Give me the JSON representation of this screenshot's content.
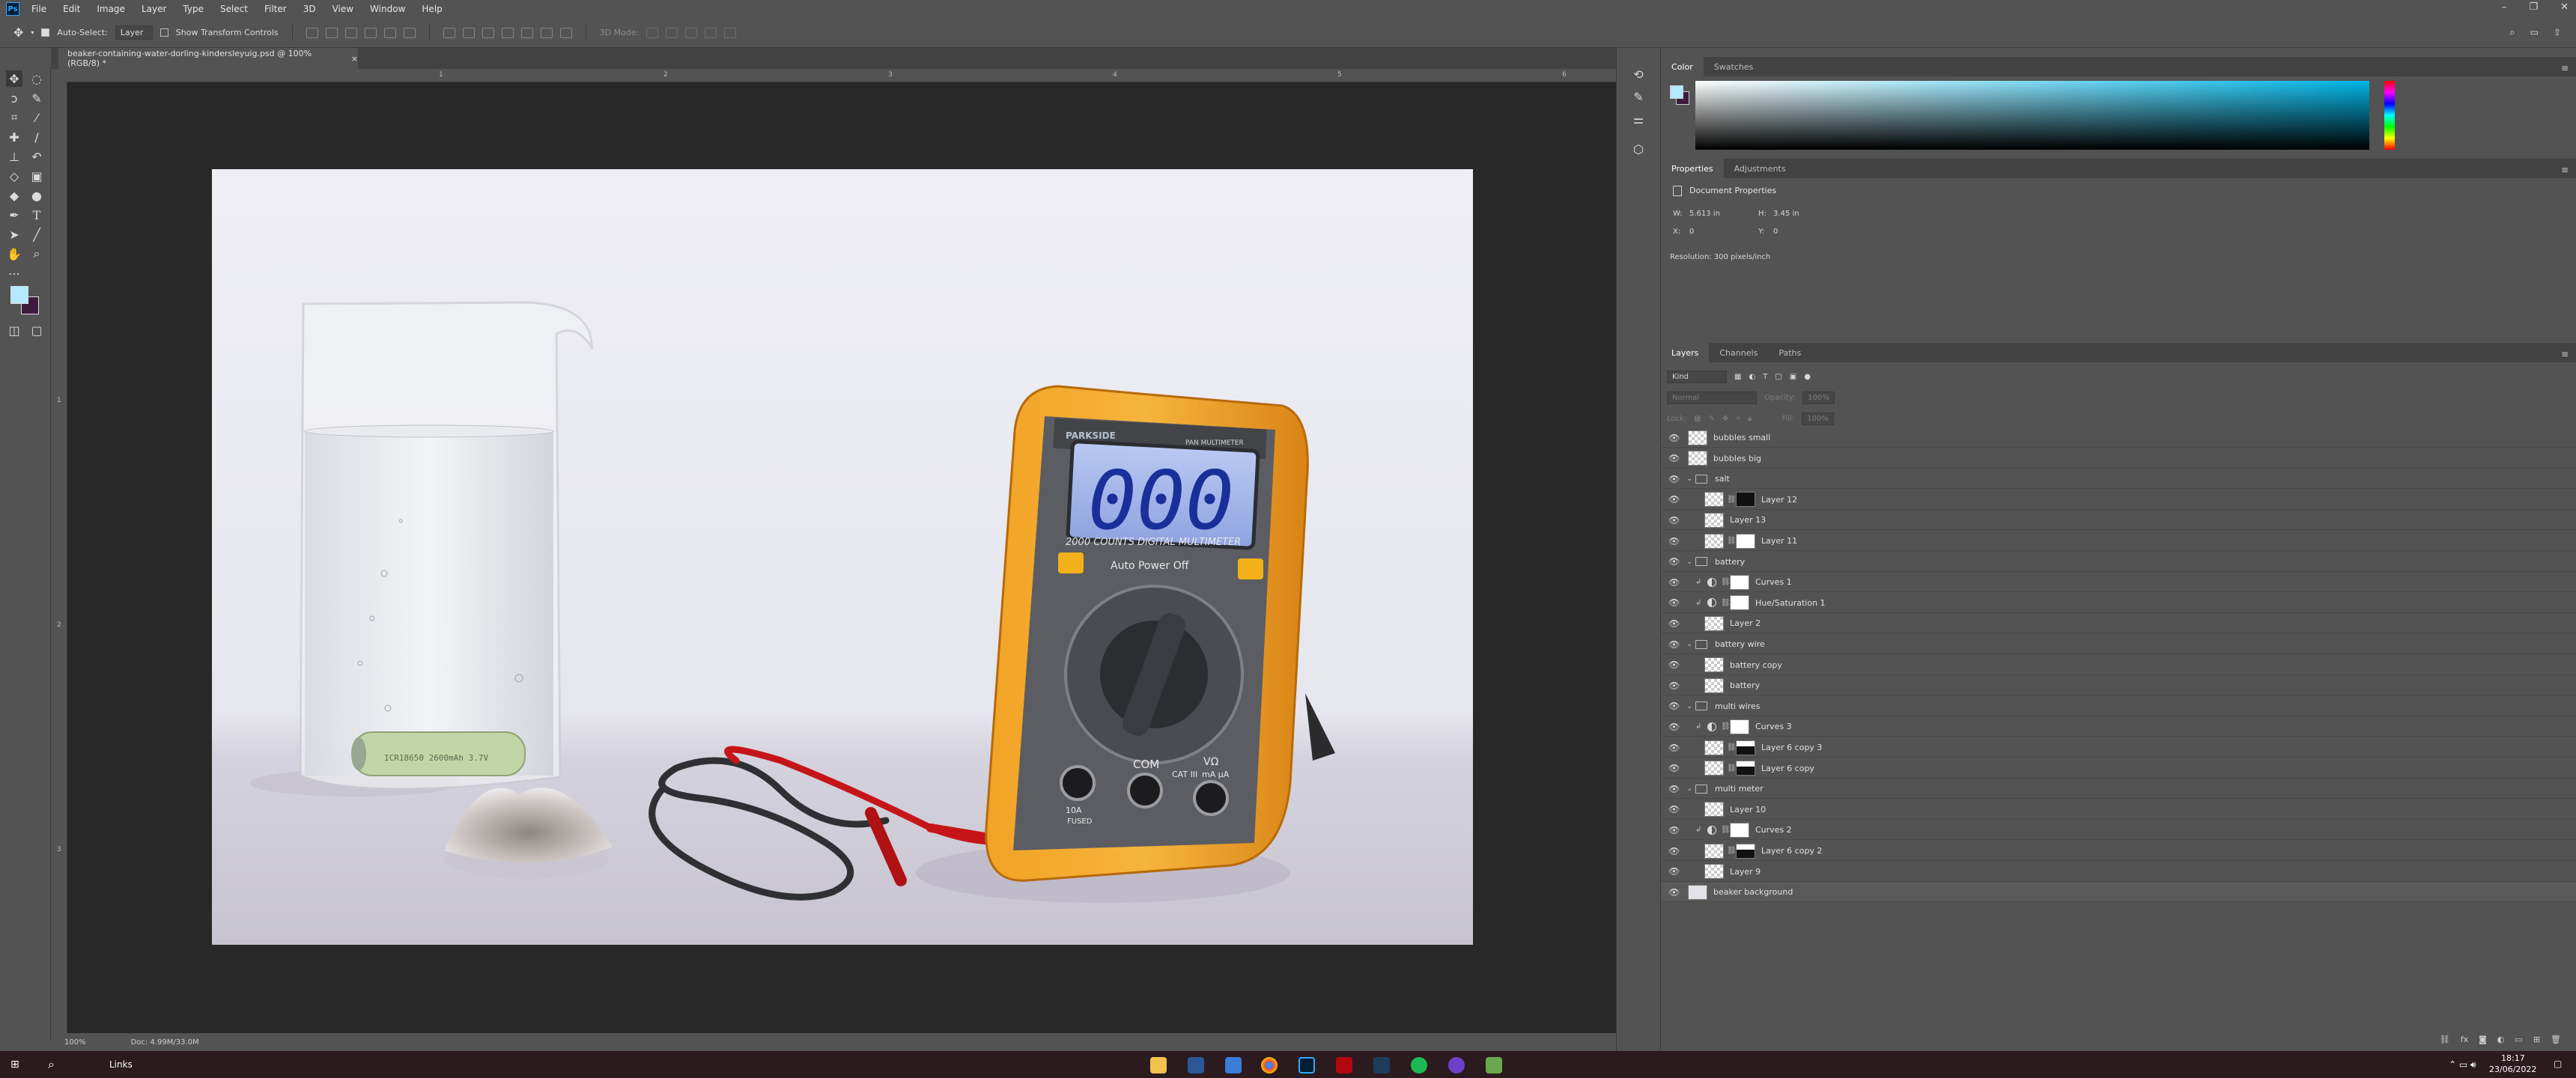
{
  "menu": {
    "logo": "Ps",
    "items": [
      "File",
      "Edit",
      "Image",
      "Layer",
      "Type",
      "Select",
      "Filter",
      "3D",
      "View",
      "Window",
      "Help"
    ],
    "window_controls": [
      "–",
      "❐",
      "✕"
    ]
  },
  "options_bar": {
    "auto_select_label": "Auto-Select:",
    "auto_select_value": "Layer",
    "show_transform_label": "Show Transform Controls",
    "mode_3d_label": "3D Mode:"
  },
  "document": {
    "tab_title": "beaker-containing-water-dorling-kindersleyuig.psd @ 100% (RGB/8) *",
    "tab_close": "×",
    "ruler_top_numbers": [
      "1",
      "2",
      "3",
      "4",
      "5",
      "6"
    ],
    "ruler_left_numbers": [
      "1",
      "2",
      "3"
    ],
    "zoom": "100%",
    "doc_size": "Doc: 4.99M/33.0M"
  },
  "color_panel": {
    "tabs": [
      "Color",
      "Swatches"
    ],
    "foreground_color": "#b3e9ff",
    "background_color": "#3c1c3c",
    "spectrum_hue": "#00b4e6"
  },
  "properties_panel": {
    "tabs": [
      "Properties",
      "Adjustments"
    ],
    "title": "Document Properties",
    "w_label": "W:",
    "w_value": "5.613 in",
    "h_label": "H:",
    "h_value": "3.45 in",
    "x_label": "X:",
    "x_value": "0",
    "y_label": "Y:",
    "y_value": "0",
    "resolution": "Resolution: 300 pixels/inch"
  },
  "layers_panel": {
    "tabs": [
      "Layers",
      "Channels",
      "Paths"
    ],
    "filter_kind": "Kind",
    "blend_mode": "Normal",
    "opacity_label": "Opacity:",
    "opacity_value": "100%",
    "lock_label": "Lock:",
    "fill_label": "Fill:",
    "fill_value": "100%",
    "layers": [
      {
        "name": "bubbles small",
        "type": "pixel",
        "indent": 0
      },
      {
        "name": "bubbles big",
        "type": "pixel",
        "indent": 0
      },
      {
        "name": "salt",
        "type": "group",
        "indent": 0
      },
      {
        "name": "Layer 12",
        "type": "masked",
        "indent": 1,
        "mask": "dark"
      },
      {
        "name": "Layer 13",
        "type": "pixel",
        "indent": 1
      },
      {
        "name": "Layer 11",
        "type": "masked",
        "indent": 1,
        "mask": "light"
      },
      {
        "name": "battery",
        "type": "group",
        "indent": 0
      },
      {
        "name": "Curves 1",
        "type": "adjustment",
        "indent": 1
      },
      {
        "name": "Hue/Saturation 1",
        "type": "adjustment",
        "indent": 1
      },
      {
        "name": "Layer 2",
        "type": "pixel",
        "indent": 1
      },
      {
        "name": "battery wire",
        "type": "group",
        "indent": 0
      },
      {
        "name": "battery copy",
        "type": "pixel",
        "indent": 1
      },
      {
        "name": "battery",
        "type": "pixel",
        "indent": 1
      },
      {
        "name": "multi wires",
        "type": "group",
        "indent": 0
      },
      {
        "name": "Curves 3",
        "type": "adjustment",
        "indent": 1
      },
      {
        "name": "Layer 6 copy 3",
        "type": "masked",
        "indent": 1,
        "mask": "shape"
      },
      {
        "name": "Layer 6 copy",
        "type": "masked",
        "indent": 1,
        "mask": "shape"
      },
      {
        "name": "multi meter",
        "type": "group",
        "indent": 0
      },
      {
        "name": "Layer 10",
        "type": "pixel",
        "indent": 1
      },
      {
        "name": "Curves 2",
        "type": "adjustment",
        "indent": 1
      },
      {
        "name": "Layer 6 copy 2",
        "type": "masked",
        "indent": 1,
        "mask": "shape"
      },
      {
        "name": "Layer 9",
        "type": "pixel",
        "indent": 1
      },
      {
        "name": "beaker background",
        "type": "background",
        "indent": 0
      }
    ]
  },
  "artwork": {
    "battery_text": "ICR18650 2600mAh 3.7V",
    "meter_brand": "PARKSIDE",
    "meter_model": "PAN MULTIMETER",
    "display": "000",
    "counts": "2000 COUNTS   DIGITAL MULTIMETER",
    "auto_off": "Auto Power Off",
    "com": "COM",
    "cat": "CAT III",
    "v_ohm": "VΩ",
    "ma": "mA μA",
    "a10": "10A",
    "fused": "FUSED"
  },
  "taskbar": {
    "search_placeholder": "Links",
    "time": "18:17",
    "date": "23/06/2022"
  }
}
